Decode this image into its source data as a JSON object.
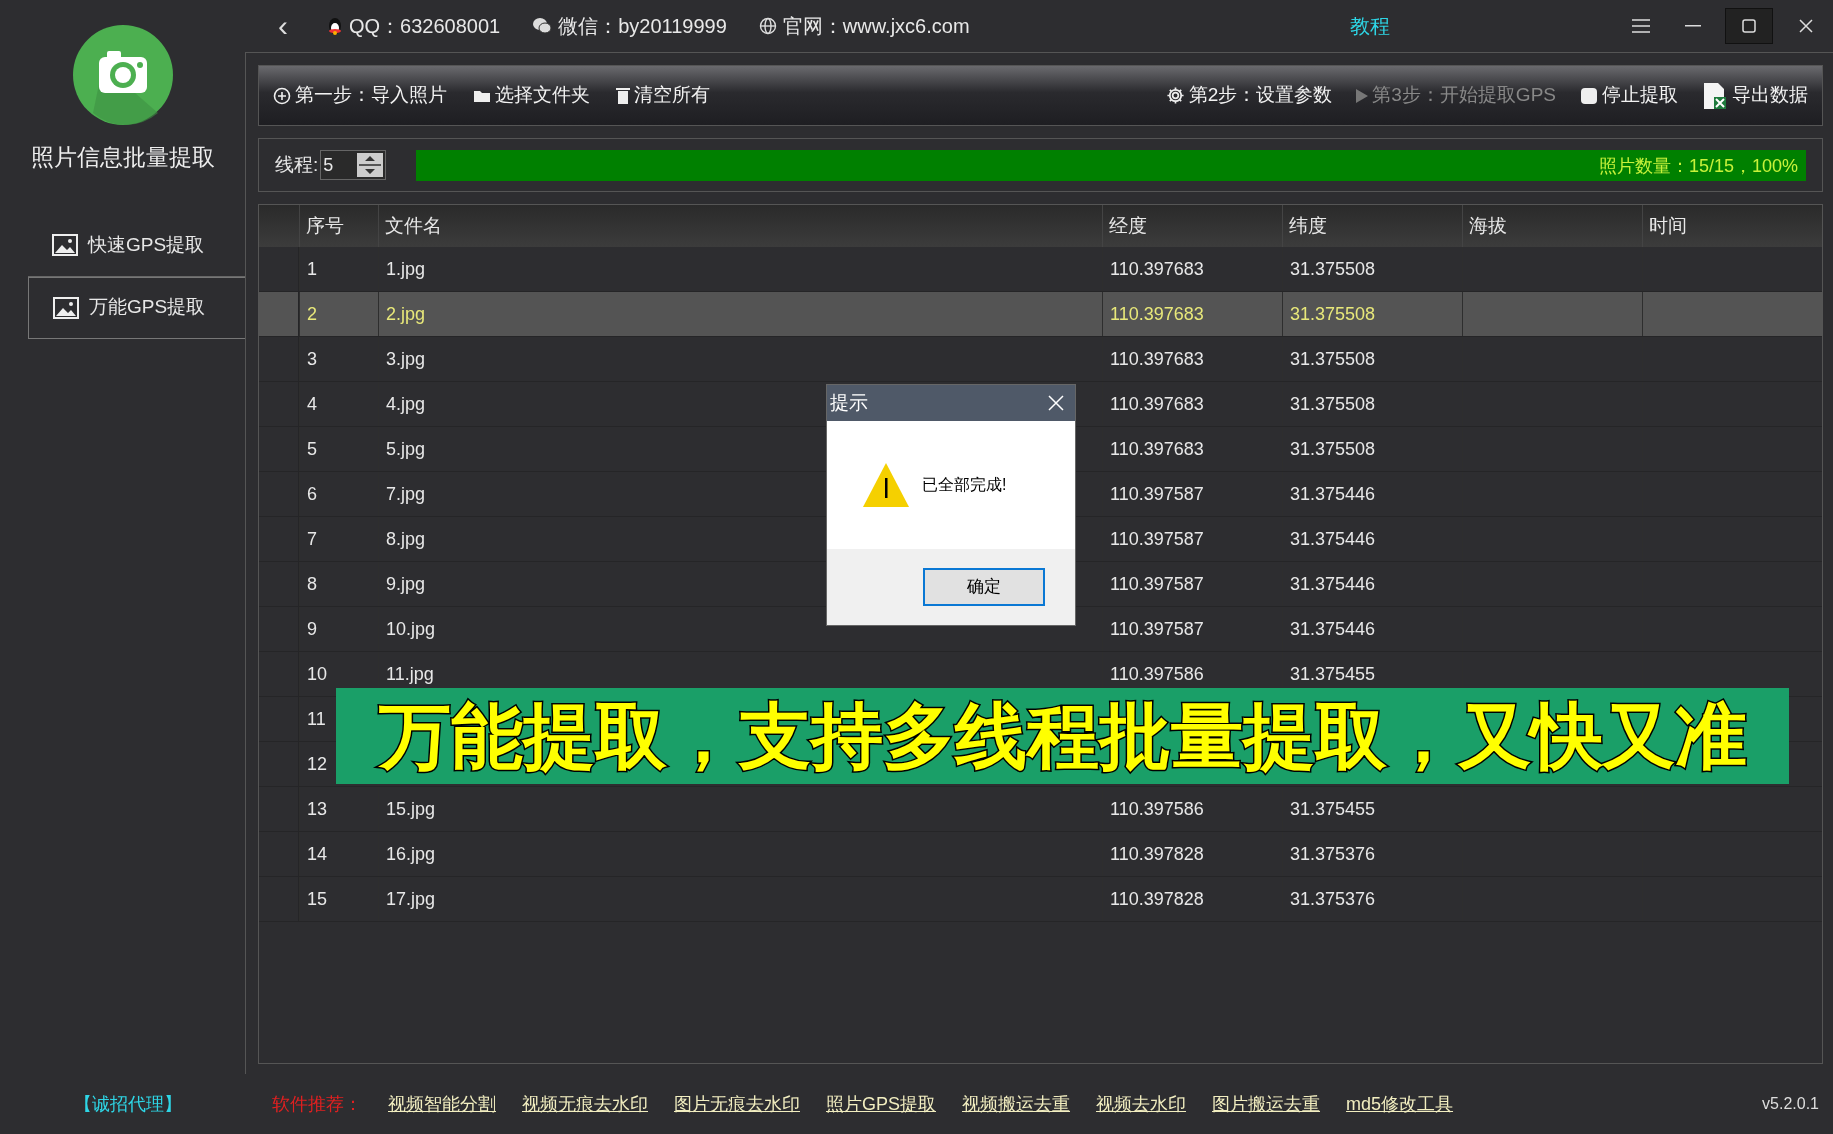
{
  "app": {
    "title": "照片信息批量提取"
  },
  "sidebar": {
    "items": [
      {
        "label": "快速GPS提取",
        "selected": false
      },
      {
        "label": "万能GPS提取",
        "selected": true
      }
    ]
  },
  "top_bar": {
    "back": "‹",
    "contacts": [
      {
        "kind": "qq",
        "text": "QQ：632608001"
      },
      {
        "kind": "wechat",
        "text": "微信：by20119999"
      },
      {
        "kind": "web",
        "text": "官网：www.jxc6.com"
      }
    ],
    "tutorial": "教程"
  },
  "toolbar": {
    "left": [
      {
        "kind": "add",
        "label": "第一步：导入照片",
        "disabled": false
      },
      {
        "kind": "folder",
        "label": "选择文件夹",
        "disabled": false
      },
      {
        "kind": "trash",
        "label": "清空所有",
        "disabled": false
      }
    ],
    "right": [
      {
        "kind": "gear",
        "label": "第2步：设置参数",
        "disabled": false
      },
      {
        "kind": "play",
        "label": "第3步：开始提取GPS",
        "disabled": true
      },
      {
        "kind": "stop",
        "label": "停止提取",
        "disabled": false
      },
      {
        "kind": "excel",
        "label": "导出数据",
        "disabled": false
      }
    ]
  },
  "threads": {
    "label": "线程:",
    "value": "5"
  },
  "progress": {
    "level": 1,
    "text": "照片数量：15/15，100%"
  },
  "table": {
    "columns": [
      "序号",
      "文件名",
      "经度",
      "纬度",
      "海拔",
      "时间"
    ],
    "rows": [
      {
        "cells": [
          "1",
          "1.jpg",
          "110.397683",
          "31.375508"
        ],
        "selected": false
      },
      {
        "cells": [
          "2",
          "2.jpg",
          "110.397683",
          "31.375508"
        ],
        "selected": true
      },
      {
        "cells": [
          "3",
          "3.jpg",
          "110.397683",
          "31.375508"
        ],
        "selected": false
      },
      {
        "cells": [
          "4",
          "4.jpg",
          "110.397683",
          "31.375508"
        ],
        "selected": false
      },
      {
        "cells": [
          "5",
          "5.jpg",
          "110.397683",
          "31.375508"
        ],
        "selected": false
      },
      {
        "cells": [
          "6",
          "7.jpg",
          "110.397587",
          "31.375446"
        ],
        "selected": false
      },
      {
        "cells": [
          "7",
          "8.jpg",
          "110.397587",
          "31.375446"
        ],
        "selected": false
      },
      {
        "cells": [
          "8",
          "9.jpg",
          "110.397587",
          "31.375446"
        ],
        "selected": false
      },
      {
        "cells": [
          "9",
          "10.jpg",
          "110.397587",
          "31.375446"
        ],
        "selected": false
      },
      {
        "cells": [
          "10",
          "11.jpg",
          "110.397586",
          "31.375455"
        ],
        "selected": false
      },
      {
        "cells": [
          "11"
        ],
        "selected": false
      },
      {
        "cells": [
          "12"
        ],
        "selected": false
      },
      {
        "cells": [
          "13",
          "15.jpg",
          "110.397586",
          "31.375455"
        ],
        "selected": false
      },
      {
        "cells": [
          "14",
          "16.jpg",
          "110.397828",
          "31.375376"
        ],
        "selected": false
      },
      {
        "cells": [
          "15",
          "17.jpg",
          "110.397828",
          "31.375376"
        ],
        "selected": false
      }
    ]
  },
  "dialog": {
    "title": "提示",
    "message": "已全部完成!",
    "button": "确定"
  },
  "banner": {
    "text": "万能提取，支持多线程批量提取，又快又准"
  },
  "footer": {
    "agent": "【诚招代理】",
    "recommend_label": "软件推荐：",
    "links": [
      "视频智能分割",
      "视频无痕去水印",
      "图片无痕去水印",
      "照片GPS提取",
      "视频搬运去重",
      "视频去水印",
      "图片搬运去重",
      "md5修改工具"
    ],
    "version": "v5.2.0.1"
  }
}
